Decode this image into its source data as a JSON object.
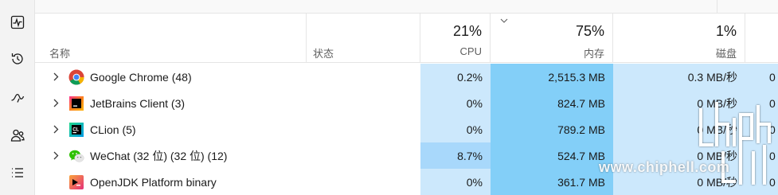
{
  "sidebar": {
    "items": [
      {
        "name": "performance-icon"
      },
      {
        "name": "app-history-icon"
      },
      {
        "name": "startup-apps-icon"
      },
      {
        "name": "users-icon"
      },
      {
        "name": "details-icon"
      }
    ]
  },
  "header": {
    "name_label": "名称",
    "status_label": "状态",
    "cpu_pct": "21%",
    "cpu_label": "CPU",
    "mem_pct": "75%",
    "mem_label": "内存",
    "disk_pct": "1%",
    "disk_label": "磁盘"
  },
  "colors": {
    "cpu_light": "#cce8fc",
    "cpu_strong": "#a8d8fb",
    "mem": "#83cff8",
    "disk": "#cce8fc",
    "accent": "#0067c0"
  },
  "processes": [
    {
      "name": "Google Chrome (48)",
      "icon": "chrome-icon",
      "expandable": true,
      "cpu": "0.2%",
      "memory": "2,515.3 MB",
      "disk": "0.3 MB/秒",
      "net": "0"
    },
    {
      "name": "JetBrains Client (3)",
      "icon": "jetbrains-client-icon",
      "expandable": true,
      "cpu": "0%",
      "memory": "824.7 MB",
      "disk": "0 MB/秒",
      "net": "0"
    },
    {
      "name": "CLion (5)",
      "icon": "clion-icon",
      "expandable": true,
      "cpu": "0%",
      "memory": "789.2 MB",
      "disk": "0 MB/秒",
      "net": "0"
    },
    {
      "name": "WeChat (32 位) (32 位) (12)",
      "icon": "wechat-icon",
      "expandable": true,
      "cpu": "8.7%",
      "memory": "524.7 MB",
      "disk": "0 MB/秒",
      "net": "0"
    },
    {
      "name": "OpenJDK Platform binary",
      "icon": "openjdk-icon",
      "expandable": false,
      "cpu": "0%",
      "memory": "361.7 MB",
      "disk": "0 MB/秒",
      "net": "0"
    }
  ],
  "watermark": {
    "text": "www.chiphell.com",
    "logo": "chiphell-logo"
  }
}
